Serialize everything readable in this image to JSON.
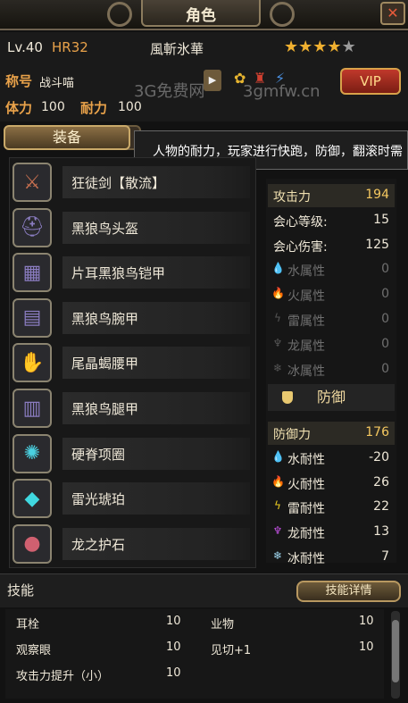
{
  "window": {
    "title": "角色",
    "close_icon": "crossed-tools-icon"
  },
  "header": {
    "level": "Lv.40",
    "hr": "HR32",
    "player_name": "風斬氷華",
    "rating": {
      "stars_filled": 4,
      "stars_total": 5
    },
    "title_label": "称号",
    "title_value": "战斗喵",
    "stamina_label": "体力",
    "stamina_value": "100",
    "endurance_label": "耐力",
    "endurance_value": "100",
    "vip_label": "VIP",
    "watermark_cn": "3G免费网",
    "watermark_url": "3gmfw.cn"
  },
  "tabs": {
    "equipment": "装备"
  },
  "tooltip": "人物的耐力，玩家进行快跑，防御，翻滚时需",
  "equipment": [
    {
      "name": "狂徒剑【散流】",
      "icon": "dual-blades-icon"
    },
    {
      "name": "黑狼鸟头盔",
      "icon": "helmet-icon"
    },
    {
      "name": "片耳黑狼鸟铠甲",
      "icon": "chest-armor-icon"
    },
    {
      "name": "黑狼鸟腕甲",
      "icon": "arm-armor-icon"
    },
    {
      "name": "尾晶蝎腰甲",
      "icon": "waist-armor-icon"
    },
    {
      "name": "黑狼鸟腿甲",
      "icon": "leg-armor-icon"
    },
    {
      "name": "硬脊项圈",
      "icon": "necklace-icon"
    },
    {
      "name": "雷光琥珀",
      "icon": "gem-icon"
    },
    {
      "name": "龙之护石",
      "icon": "talisman-icon"
    }
  ],
  "attack_stats": [
    {
      "label": "攻击力",
      "value": "194",
      "highlight": true
    },
    {
      "label": "会心等级:",
      "value": "15"
    },
    {
      "label": "会心伤害:",
      "value": "125"
    },
    {
      "label": "水属性",
      "value": "0",
      "dim": true,
      "icon": "water-icon"
    },
    {
      "label": "火属性",
      "value": "0",
      "dim": true,
      "icon": "fire-icon"
    },
    {
      "label": "雷属性",
      "value": "0",
      "dim": true,
      "icon": "thunder-icon"
    },
    {
      "label": "龙属性",
      "value": "0",
      "dim": true,
      "icon": "dragon-icon"
    },
    {
      "label": "冰属性",
      "value": "0",
      "dim": true,
      "icon": "ice-icon"
    }
  ],
  "defense_section": {
    "title": "防御",
    "icon": "shield-icon"
  },
  "defense_stats": [
    {
      "label": "防御力",
      "value": "176",
      "highlight": true
    },
    {
      "label": "水耐性",
      "value": "-20",
      "icon": "water-icon",
      "color": "#5ab8f0"
    },
    {
      "label": "火耐性",
      "value": "26",
      "icon": "fire-icon",
      "color": "#e85a2a"
    },
    {
      "label": "雷耐性",
      "value": "22",
      "icon": "thunder-icon",
      "color": "#f0d020"
    },
    {
      "label": "龙耐性",
      "value": "13",
      "icon": "dragon-icon",
      "color": "#c050e0"
    },
    {
      "label": "冰耐性",
      "value": "7",
      "icon": "ice-icon",
      "color": "#a0d8f0"
    }
  ],
  "skills": {
    "title": "技能",
    "details_button": "技能详情",
    "items": [
      {
        "name": "耳栓",
        "value": "10"
      },
      {
        "name": "业物",
        "value": "10"
      },
      {
        "name": "观察眼",
        "value": "10"
      },
      {
        "name": "见切+1",
        "value": "10"
      },
      {
        "name": "攻击力提升（小）",
        "value": "10"
      }
    ]
  }
}
